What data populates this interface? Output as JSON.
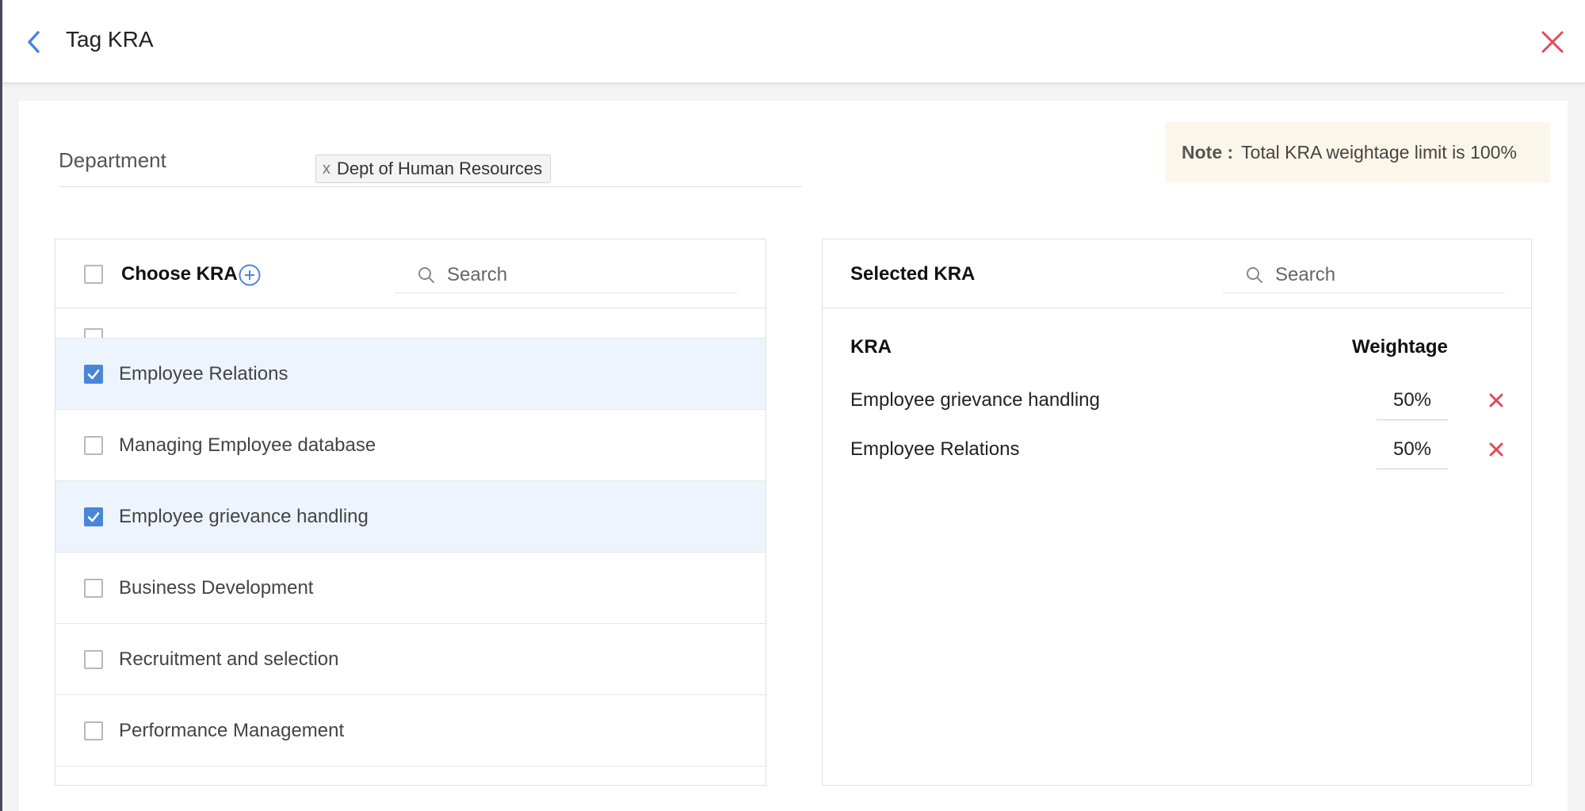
{
  "header": {
    "title": "Tag KRA"
  },
  "department": {
    "label": "Department",
    "chip_label": "Dept of Human Resources",
    "chip_remove": "x"
  },
  "note": {
    "label": "Note :",
    "text": "Total KRA weightage limit is 100%"
  },
  "choose_panel": {
    "title": "Choose KRA",
    "search_placeholder": "Search",
    "items": [
      {
        "label": "",
        "checked": false,
        "partial": true
      },
      {
        "label": "Employee Relations",
        "checked": true
      },
      {
        "label": "Managing Employee database",
        "checked": false
      },
      {
        "label": "Employee grievance handling",
        "checked": true
      },
      {
        "label": "Business Development",
        "checked": false
      },
      {
        "label": "Recruitment and selection",
        "checked": false
      },
      {
        "label": "Performance Management",
        "checked": false
      }
    ]
  },
  "selected_panel": {
    "title": "Selected KRA",
    "search_placeholder": "Search",
    "col_kra": "KRA",
    "col_weightage": "Weightage",
    "rows": [
      {
        "name": "Employee grievance handling",
        "weightage": "50%"
      },
      {
        "name": "Employee Relations",
        "weightage": "50%"
      }
    ]
  },
  "colors": {
    "accent": "#4a86d8",
    "danger": "#e04b5a",
    "note_bg": "#fbf6ea",
    "selected_row_bg": "#eef4fd"
  }
}
